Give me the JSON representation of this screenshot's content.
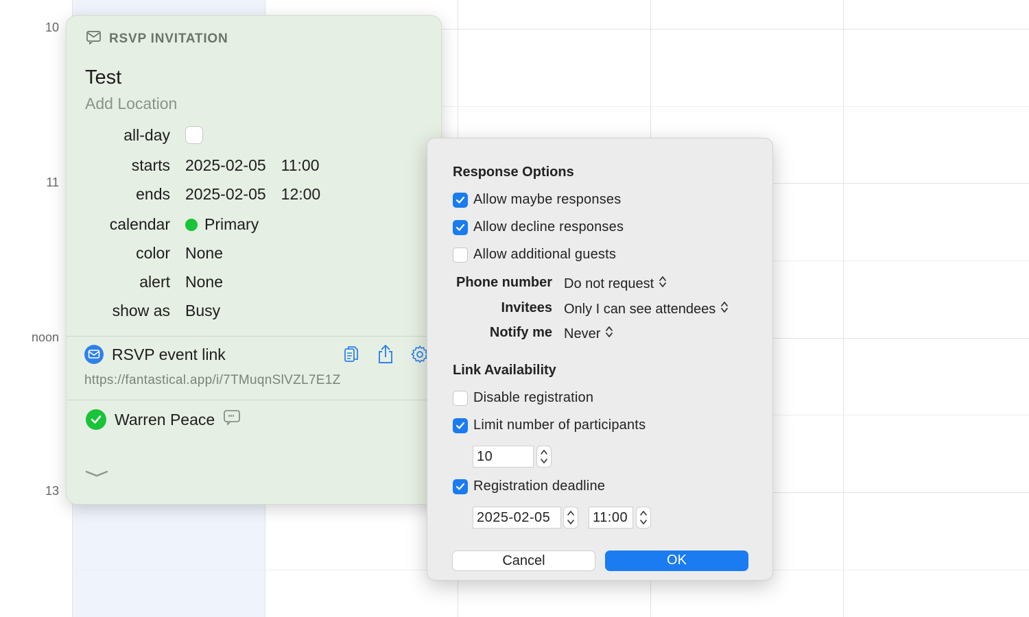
{
  "calendar": {
    "hour_labels": [
      "10",
      "11",
      "noon",
      "13"
    ]
  },
  "event": {
    "header": "RSVP INVITATION",
    "title": "Test",
    "location_placeholder": "Add Location",
    "fields": {
      "allday_label": "all-day",
      "allday_checked": false,
      "starts_label": "starts",
      "starts_date": "2025-02-05",
      "starts_time": "11:00",
      "ends_label": "ends",
      "ends_date": "2025-02-05",
      "ends_time": "12:00",
      "calendar_label": "calendar",
      "calendar_value": "Primary",
      "calendar_color": "#19c33a",
      "color_label": "color",
      "color_value": "None",
      "alert_label": "alert",
      "alert_value": "None",
      "showas_label": "show as",
      "showas_value": "Busy"
    },
    "rsvp": {
      "label": "RSVP event link",
      "url": "https://fantastical.app/i/7TMuqnSlVZL7E1Z",
      "icons": [
        "copy-icon",
        "share-icon",
        "gear-icon"
      ]
    },
    "attendee": {
      "name": "Warren Peace",
      "status": "accepted"
    }
  },
  "panel": {
    "response_heading": "Response Options",
    "options": [
      {
        "label": "Allow maybe responses",
        "checked": true
      },
      {
        "label": "Allow decline responses",
        "checked": true
      },
      {
        "label": "Allow additional guests",
        "checked": false
      }
    ],
    "phone_label": "Phone number",
    "phone_value": "Do not request",
    "invitees_label": "Invitees",
    "invitees_value": "Only I can see attendees",
    "notify_label": "Notify me",
    "notify_value": "Never",
    "link_heading": "Link Availability",
    "disable_label": "Disable registration",
    "disable_checked": false,
    "limit_label": "Limit number of participants",
    "limit_checked": true,
    "limit_value": "10",
    "deadline_label": "Registration deadline",
    "deadline_checked": true,
    "deadline_date": "2025-02-05",
    "deadline_time": "11:00",
    "cancel_label": "Cancel",
    "ok_label": "OK",
    "accent_color": "#1a7cf0"
  }
}
